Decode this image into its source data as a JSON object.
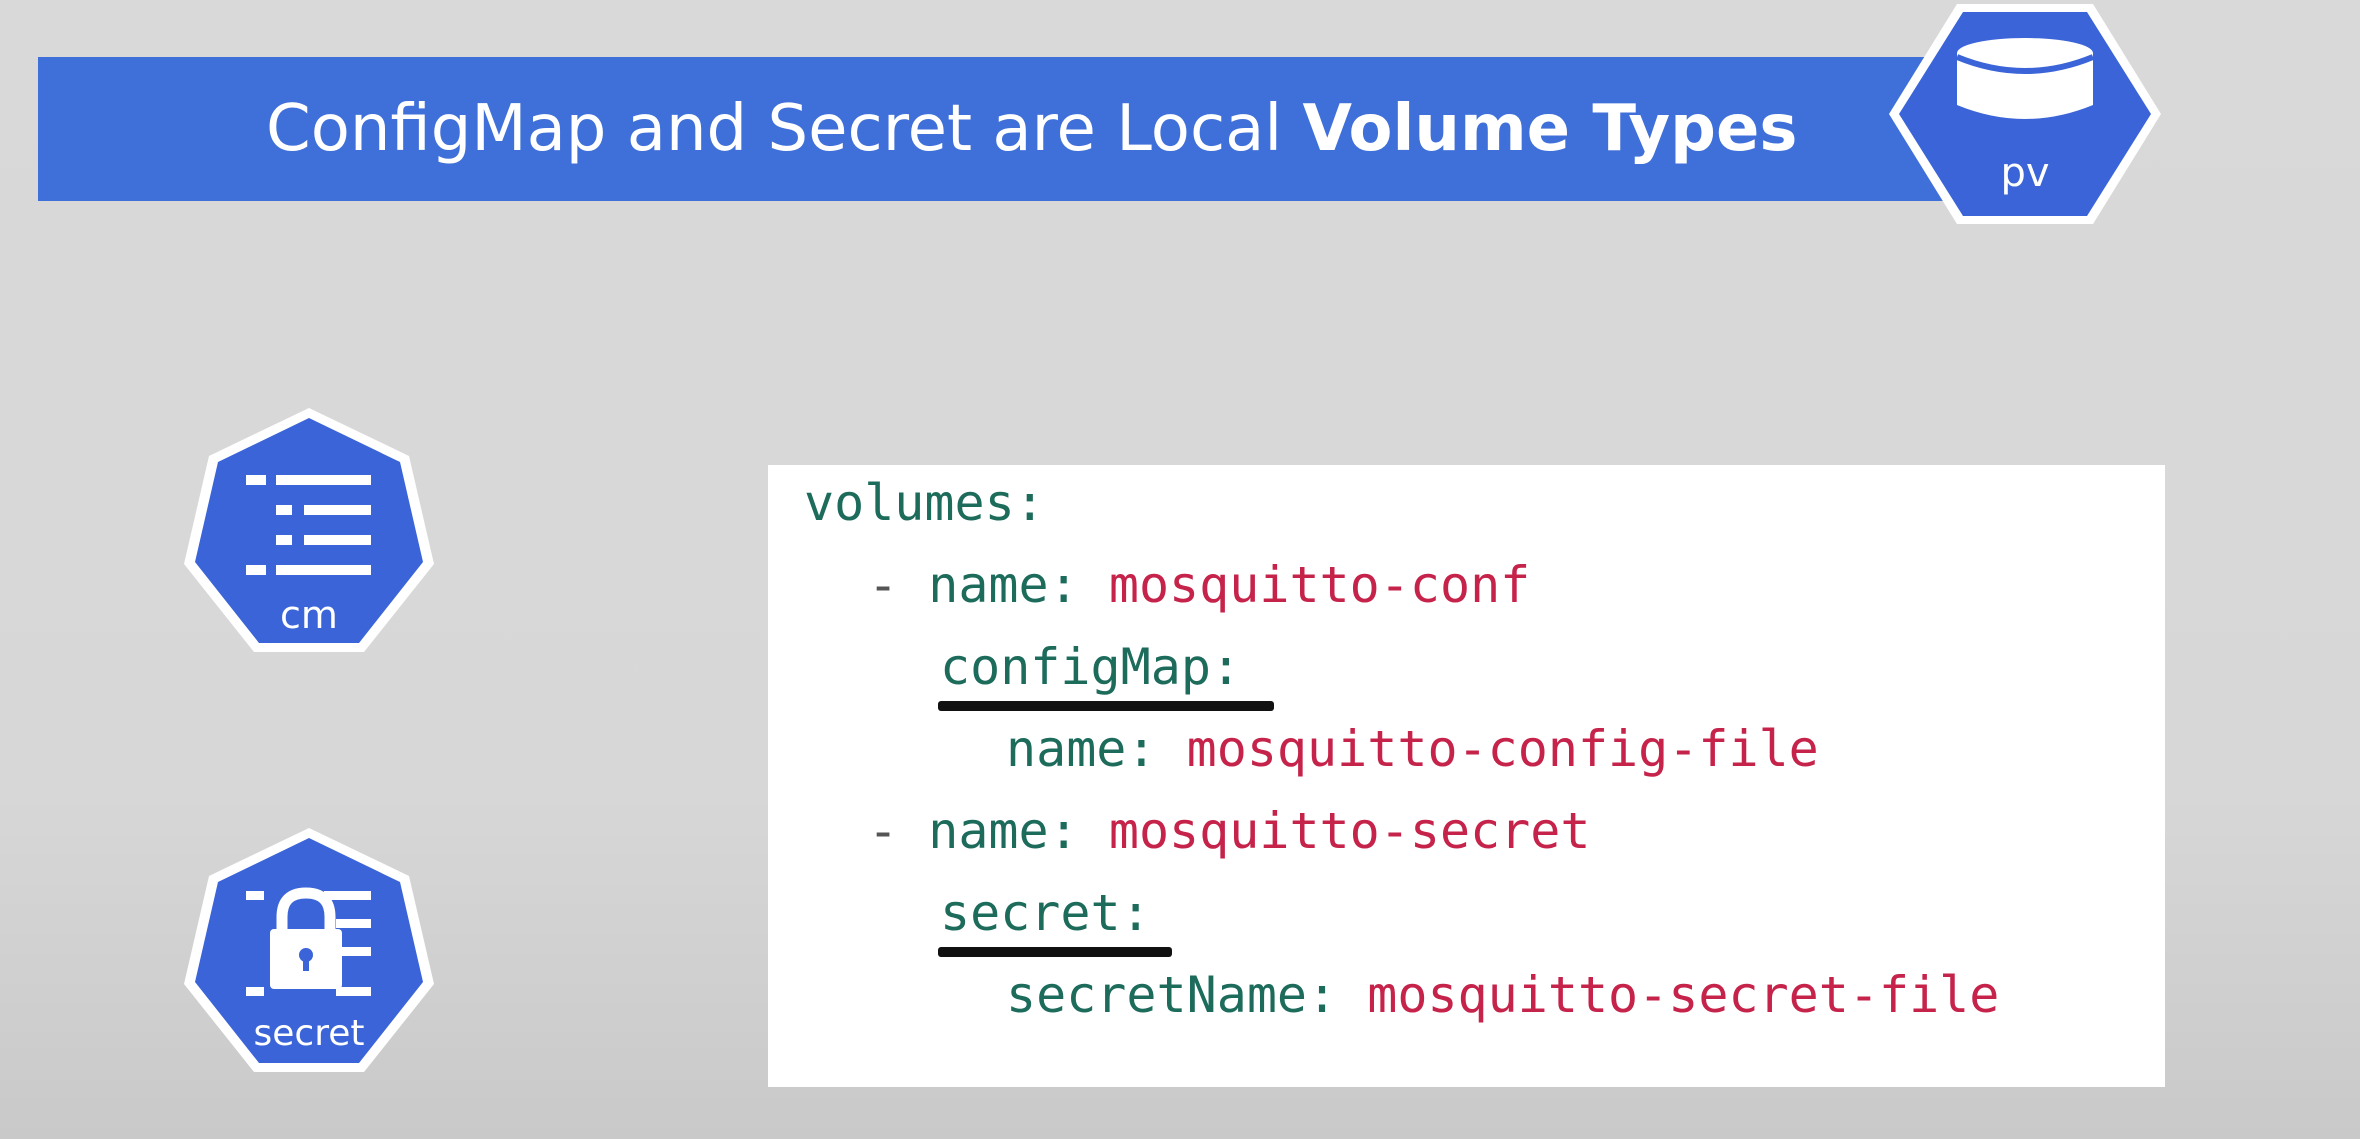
{
  "header": {
    "title_regular": "ConfigMap and Secret are Local ",
    "title_bold": "Volume Types"
  },
  "badges": {
    "pv": {
      "label": "pv",
      "icon": "database-icon",
      "color": "#3a64d8"
    },
    "cm": {
      "label": "cm",
      "icon": "configmap-list-icon",
      "color": "#3a64d8"
    },
    "secret": {
      "label": "secret",
      "icon": "lock-icon",
      "color": "#3a64d8"
    }
  },
  "code": {
    "line1_key": "volumes:",
    "line2_dash": "- ",
    "line2_key": "name: ",
    "line2_value": "mosquitto-conf",
    "line3_key": "configMap:",
    "line4_key": "name: ",
    "line4_value": "mosquitto-config-file",
    "line5_dash": "- ",
    "line5_key": "name: ",
    "line5_value": "mosquitto-secret",
    "line6_key": "secret:",
    "line7_key": "secretName: ",
    "line7_value": "mosquitto-secret-file",
    "key_color": "#1c6b5b",
    "value_color": "#c6234b"
  }
}
